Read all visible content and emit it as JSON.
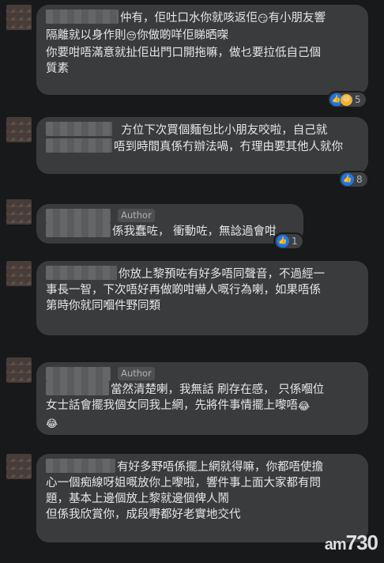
{
  "author_badge": "Author",
  "comments": [
    {
      "lines": [
        "仲有，佢吐口水你就咳返佢",
        "有小朋友響",
        "隔離就以身作則",
        "你做啲咩佢睇晒㗎",
        "你要咁唔滿意就扯佢出門口開拖嘛，做乜要拉低自己個",
        "質素"
      ],
      "reactions": {
        "count": "5",
        "types": [
          "like",
          "haha"
        ]
      }
    },
    {
      "lines": [
        "方位下次買個麵包比小朋友咬啦，自己就",
        "唔到時間真係冇辦法喎，冇理由要其他人就你"
      ],
      "reactions": {
        "count": "8",
        "types": [
          "like"
        ]
      }
    },
    {
      "lines": [
        "係我蠢咗， 衝動咗，無諗過會咁"
      ],
      "reactions": {
        "count": "1",
        "types": [
          "like"
        ]
      }
    },
    {
      "lines": [
        "你放上黎預咗有好多唔同聲音，不過經一",
        "事長一智，下次唔好再做啲咁嚇人嘅行為喇，如果唔係",
        "第時你就同嗰件野同類"
      ]
    },
    {
      "lines": [
        "當然清楚喇，我無話 刷存在感， 只係嗰位",
        "女士話會擺我個女同我上網，先將件事情擺上嚟唔"
      ]
    },
    {
      "lines": [
        "有好多野唔係擺上網就得嘛，你都唔使擔",
        "心一個痴線呀姐嘅放你上嚟啦，響件事上面大家都有問",
        "題，基本上邊個放上黎就邊個俾人鬧",
        "但係我欣賞你，成段嘢都好老實地交代"
      ]
    }
  ],
  "watermark": {
    "prefix": "am",
    "number": "730"
  }
}
